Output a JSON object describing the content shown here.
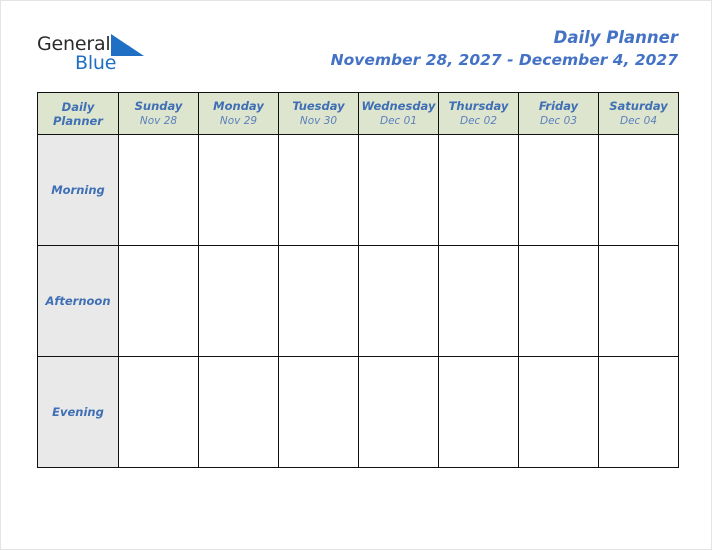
{
  "brand": {
    "name_part1": "General",
    "name_part2": "Blue",
    "mark": "triangle-flag-icon",
    "accent_color": "#1f6fc4",
    "text_color": "#2b2b2b"
  },
  "header": {
    "title": "Daily Planner",
    "date_range": "November 28, 2027 - December 4, 2027",
    "title_color": "#4472c4"
  },
  "table": {
    "corner": {
      "line1": "Daily",
      "line2": "Planner"
    },
    "header_bg": "#dee5ce",
    "label_bg": "#e9e9e9",
    "border_color": "#111111",
    "columns": [
      {
        "day": "Sunday",
        "date": "Nov 28"
      },
      {
        "day": "Monday",
        "date": "Nov 29"
      },
      {
        "day": "Tuesday",
        "date": "Nov 30"
      },
      {
        "day": "Wednesday",
        "date": "Dec 01"
      },
      {
        "day": "Thursday",
        "date": "Dec 02"
      },
      {
        "day": "Friday",
        "date": "Dec 03"
      },
      {
        "day": "Saturday",
        "date": "Dec 04"
      }
    ],
    "rows": [
      {
        "label": "Morning",
        "cells": [
          "",
          "",
          "",
          "",
          "",
          "",
          ""
        ]
      },
      {
        "label": "Afternoon",
        "cells": [
          "",
          "",
          "",
          "",
          "",
          "",
          ""
        ]
      },
      {
        "label": "Evening",
        "cells": [
          "",
          "",
          "",
          "",
          "",
          "",
          ""
        ]
      }
    ]
  }
}
